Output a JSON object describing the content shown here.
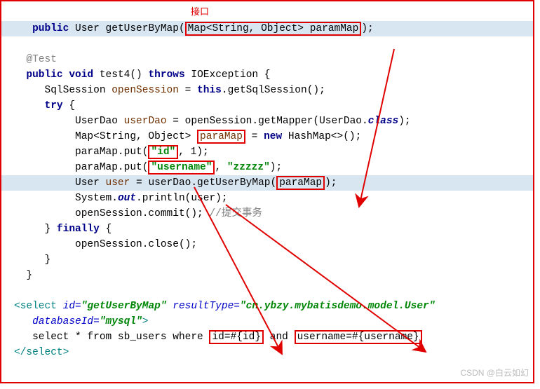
{
  "header_label": "接口",
  "l1": {
    "public": "public",
    "type_user": "User",
    "m": "getUserByMap",
    "sig_a": "Map<String, Object>",
    "sig_b": "paramMap",
    "end": ");"
  },
  "l2": {
    "anno": "@Test"
  },
  "l3": {
    "public": "public",
    "void": "void",
    "name": "test4",
    "throws": "throws",
    "exc": "IOException {"
  },
  "l4": {
    "t1": "SqlSession",
    "var": "openSession",
    "eq": " = ",
    "this": "this",
    "rest": ".getSqlSession();"
  },
  "l5": {
    "try": "try",
    "br": " {"
  },
  "l6": {
    "a": "UserDao ",
    "v": "userDao",
    "b": " = openSession.getMapper(UserDao.",
    "c": "class",
    "d": ");"
  },
  "l7": {
    "a": "Map<String, Object>",
    "boxed": "paraMap",
    "eq": " = ",
    "new": "new",
    "rest": " HashMap<>();"
  },
  "l8": {
    "a": "paraMap.put(",
    "boxed": "\"id\"",
    "rest": ", 1);"
  },
  "l9": {
    "a": "paraMap.put(",
    "boxed": "\"username\"",
    "mid": ", ",
    "str2": "\"zzzzz\"",
    "end": ");"
  },
  "l10": {
    "a": "User ",
    "v": "user",
    "b": " = userDao.getUserByMap(",
    "boxed": "paraMap",
    "end": ");"
  },
  "l11": {
    "a": "System.",
    "out": "out",
    "b": ".println(user);"
  },
  "l12": {
    "a": "openSession.commit(); ",
    "cmt": "//提交事务"
  },
  "l13": {
    "a": "} ",
    "fin": "finally",
    "b": " {"
  },
  "l14": {
    "a": "openSession.close();"
  },
  "l15": {
    "a": "}"
  },
  "l16": {
    "a": "}"
  },
  "xml": {
    "open_a": "<",
    "open_b": "select",
    "sp": " ",
    "id_k": "id",
    "id_v": "\"getUserByMap\"",
    "rt_k": "resultType",
    "rt_v": "\"cn.ybzy.mybatisdemo.model.User\"",
    "db_k": "databaseId",
    "db_v": "\"mysql\"",
    "close_gt": ">",
    "sql_a": "select * from sb_users where ",
    "box1": "id=#{id}",
    "mid": " and ",
    "box2": "username=#{username}",
    "close_a": "</",
    "close_b": "select",
    "close_c": ">"
  },
  "watermark": "CSDN @白云如幻"
}
